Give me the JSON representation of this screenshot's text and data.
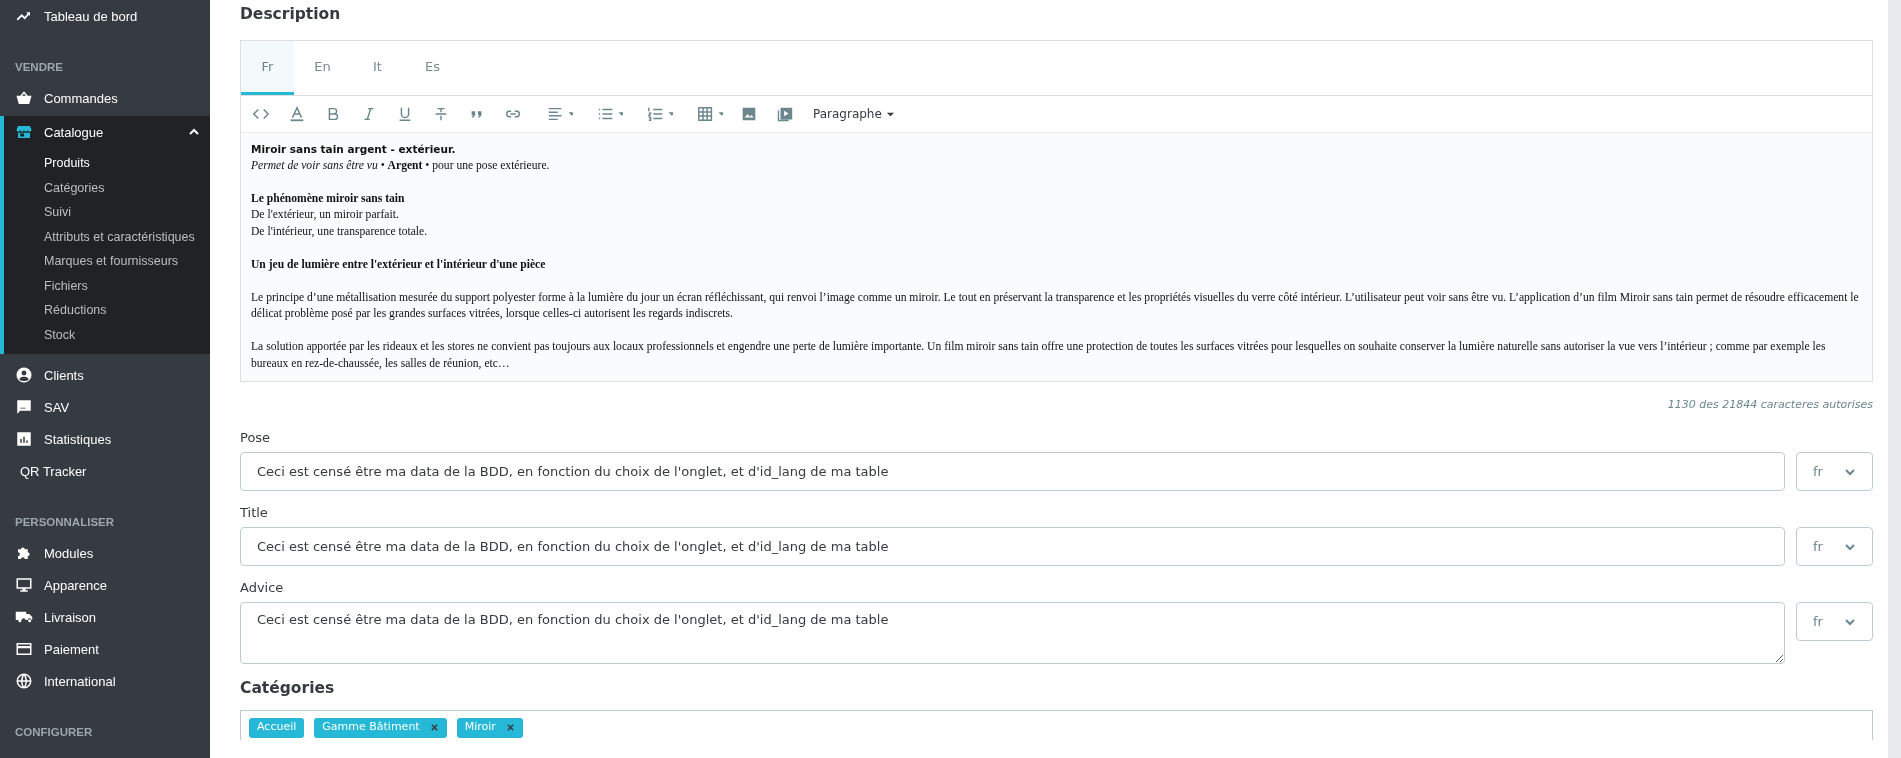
{
  "sidebar": {
    "items": [
      {
        "kind": "item",
        "label": "Tableau de bord",
        "selected": false
      },
      {
        "kind": "heading",
        "label": "VENDRE"
      },
      {
        "kind": "item",
        "label": "Commandes",
        "selected": false
      },
      {
        "kind": "item",
        "label": "Catalogue",
        "selected": true,
        "expanded": true,
        "children": [
          {
            "label": "Produits",
            "selected": true
          },
          {
            "label": "Catégories",
            "selected": false
          },
          {
            "label": "Suivi",
            "selected": false
          },
          {
            "label": "Attributs et caractéristiques",
            "selected": false
          },
          {
            "label": "Marques et fournisseurs",
            "selected": false
          },
          {
            "label": "Fichiers",
            "selected": false
          },
          {
            "label": "Réductions",
            "selected": false
          },
          {
            "label": "Stock",
            "selected": false
          }
        ]
      },
      {
        "kind": "item",
        "label": "Clients",
        "selected": false
      },
      {
        "kind": "item",
        "label": "SAV",
        "selected": false
      },
      {
        "kind": "item",
        "label": "Statistiques",
        "selected": false
      },
      {
        "kind": "plain",
        "label": "QR Tracker",
        "selected": false
      },
      {
        "kind": "heading",
        "label": "PERSONNALISER"
      },
      {
        "kind": "item",
        "label": "Modules",
        "selected": false
      },
      {
        "kind": "item",
        "label": "Apparence",
        "selected": false
      },
      {
        "kind": "item",
        "label": "Livraison",
        "selected": false
      },
      {
        "kind": "item",
        "label": "Paiement",
        "selected": false
      },
      {
        "kind": "item",
        "label": "International",
        "selected": false
      },
      {
        "kind": "heading",
        "label": "CONFIGURER"
      }
    ]
  },
  "description": {
    "title": "Description",
    "tabs": [
      {
        "label": "Fr",
        "selected": true
      },
      {
        "label": "En",
        "selected": false
      },
      {
        "label": "It",
        "selected": false
      },
      {
        "label": "Es",
        "selected": false
      }
    ],
    "format_select": "Paragraphe",
    "content": [
      {
        "kind": "intro",
        "title": "Miroir sans tain argent - extérieur.",
        "lines": [
          "*Permet de voir sans être vu*  • **Argent** • pour une pose extérieure."
        ]
      },
      {
        "kind": "section",
        "title": "Le phénomène miroir sans tain",
        "lines": [
          "De l'extérieur, un miroir parfait.",
          "De l'intérieur, une transparence totale."
        ]
      },
      {
        "kind": "section",
        "title": "Un jeu de lumière entre l'extérieur et l'intérieur d'une pièce"
      },
      {
        "kind": "text",
        "lines": [
          "Le principe d’une métallisation mesurée du support polyester forme à la lumière du jour un écran réfléchissant, qui renvoi l’image comme un miroir. Le tout en préservant la transparence et les propriétés visuelles du verre côté intérieur. L’utilisateur peut voir sans être vu. L’application d’un film Miroir sans tain permet de résoudre efficacement le délicat problème posé par les grandes surfaces vitrées, lorsque celles-ci autorisent les regards indiscrets."
        ]
      },
      {
        "kind": "text",
        "lines": [
          "La solution apportée par les rideaux et les stores ne convient pas toujours aux locaux professionnels et engendre une perte de lumière importante. Un film miroir sans tain offre une protection de toutes les surfaces vitrées pour lesquelles on souhaite conserver la lumière naturelle sans autoriser la vue vers l’intérieur ; comme par exemple les bureaux en rez-de-chaussée, les salles de réunion, etc…"
        ]
      }
    ],
    "char_count": "1130 des 21844 caracteres autorises"
  },
  "fields": [
    {
      "kind": "input",
      "label": "Pose",
      "value": "Ceci est censé être ma data de la BDD, en fonction du choix de l'onglet, et d'id_lang de ma table",
      "language": "fr"
    },
    {
      "kind": "input",
      "label": "Title",
      "value": "Ceci est censé être ma data de la BDD, en fonction du choix de l'onglet, et d'id_lang de ma table",
      "language": "fr"
    },
    {
      "kind": "textarea",
      "label": "Advice",
      "value": "Ceci est censé être ma data de la BDD, en fonction du choix de l'onglet, et d'id_lang de ma table",
      "language": "fr"
    }
  ],
  "categories": {
    "title": "Catégories",
    "tags": [
      {
        "label": "Accueil",
        "removable": false
      },
      {
        "label": "Gamme Bâtiment",
        "removable": true
      },
      {
        "label": "Miroir",
        "removable": true
      }
    ]
  }
}
